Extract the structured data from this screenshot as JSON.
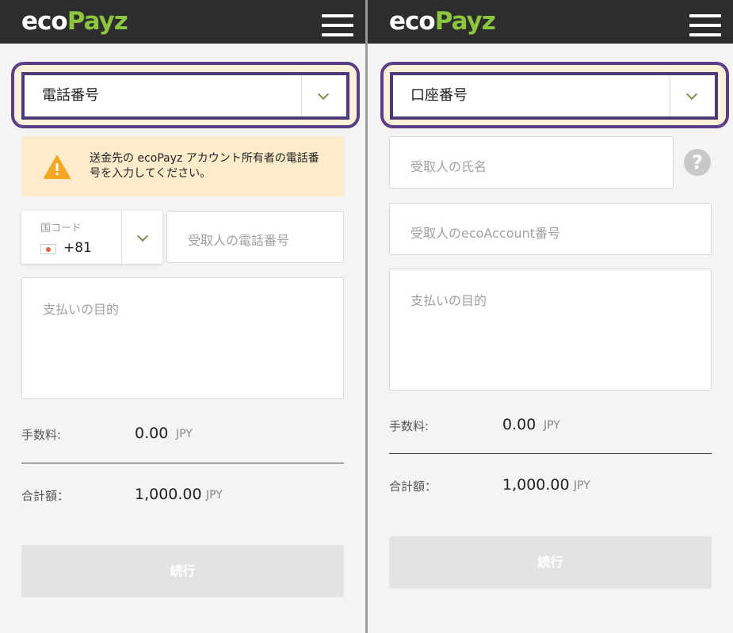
{
  "brand": {
    "logo_eco": "eco",
    "logo_payz": "Payz",
    "green": "#8cc63f",
    "header_bg": "#2d2d2d",
    "highlight": "#5b3f86"
  },
  "left": {
    "method_select": "電話番号",
    "warning_text": "送金先の ecoPayz アカウント所有者の電話番号を入力してください。",
    "country_code_label": "国コード",
    "country_code_value": "+81",
    "phone_placeholder": "受取人の電話番号",
    "purpose_placeholder": "支払いの目的",
    "fee_label": "手数料:",
    "fee_value": "0.00",
    "fee_currency": "JPY",
    "total_label": "合計額：",
    "total_value": "1,000.00",
    "total_currency": "JPY",
    "continue_label": "続行"
  },
  "right": {
    "method_select": "口座番号",
    "name_placeholder": "受取人の氏名",
    "account_placeholder": "受取人のecoAccount番号",
    "purpose_placeholder": "支払いの目的",
    "fee_label": "手数料:",
    "fee_value": "0.00",
    "fee_currency": "JPY",
    "total_label": "合計額：",
    "total_value": "1,000.00",
    "total_currency": "JPY",
    "continue_label": "続行"
  },
  "icons": {
    "menu": "hamburger-icon",
    "dropdown": "chevron-down-icon",
    "warning": "warning-triangle-icon",
    "help": "question-icon",
    "flag": "japan-flag-icon"
  }
}
